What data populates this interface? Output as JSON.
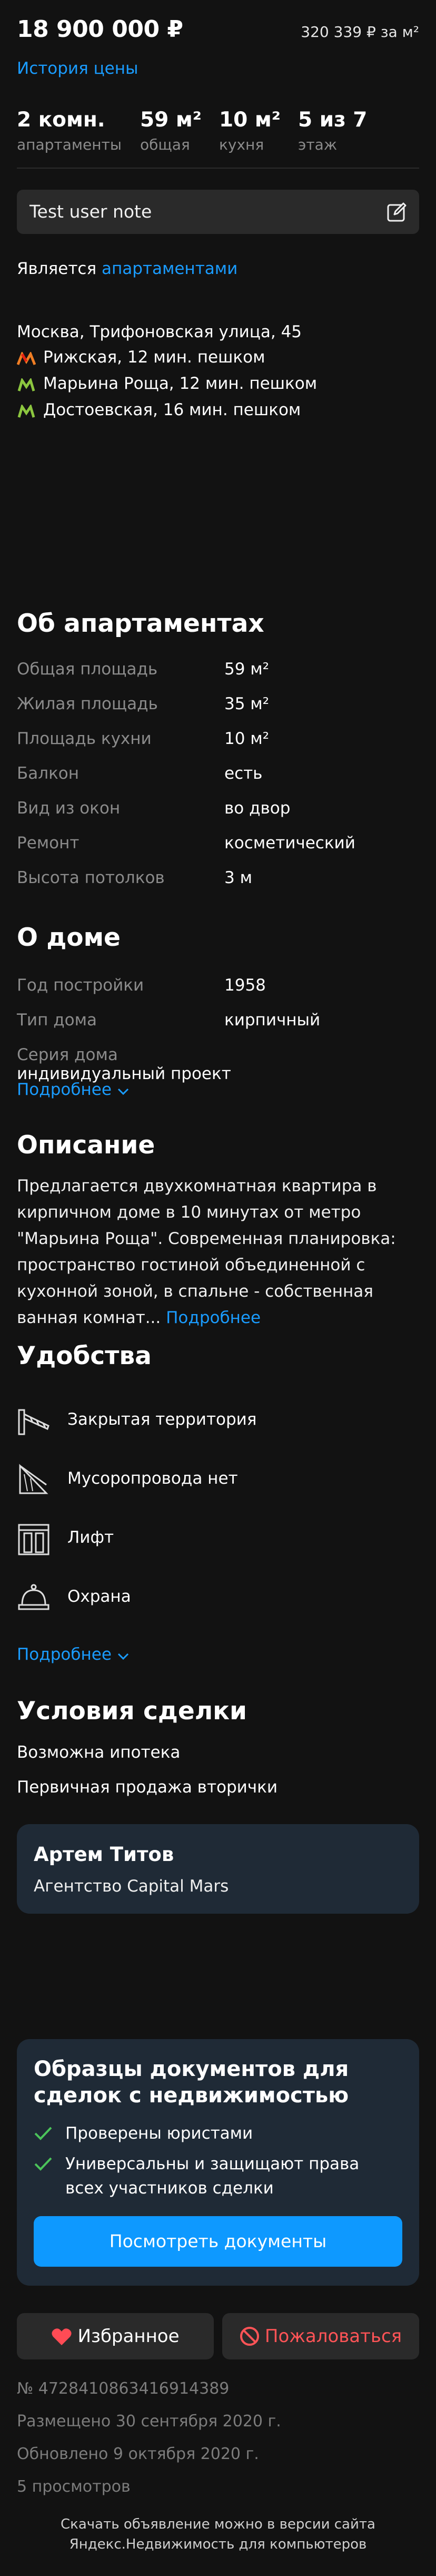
{
  "header": {
    "price": "18 900 000 ₽",
    "price_per_meter": "320 339 ₽ за м²",
    "price_history_link": "История цены"
  },
  "stats": [
    {
      "value": "2 комн.",
      "label": "апартаменты"
    },
    {
      "value": "59 м²",
      "label": "общая"
    },
    {
      "value": "10 м²",
      "label": "кухня"
    },
    {
      "value": "5 из 7",
      "label": "этаж"
    }
  ],
  "note": {
    "text": "Test user note",
    "icon": "edit-icon"
  },
  "type_line": {
    "prefix": "Является",
    "link": "апартаментами"
  },
  "location": {
    "address": "Москва, Трифоновская улица, 45",
    "metro": [
      {
        "text": "Рижская, 12 мин. пешком",
        "colors": [
          "#f07e24",
          "#e42313"
        ],
        "icon": "metro-icon"
      },
      {
        "text": "Марьина Роща, 12 мин. пешком",
        "colors": [
          "#8cc63f"
        ],
        "icon": "metro-icon"
      },
      {
        "text": "Достоевская, 16 мин. пешком",
        "colors": [
          "#8cc63f"
        ],
        "icon": "metro-icon"
      }
    ]
  },
  "about_apartment": {
    "title": "Об апартаментах",
    "rows": [
      {
        "key": "Общая площадь",
        "value": "59 м²"
      },
      {
        "key": "Жилая площадь",
        "value": "35 м²"
      },
      {
        "key": "Площадь кухни",
        "value": "10 м²"
      },
      {
        "key": "Балкон",
        "value": "есть"
      },
      {
        "key": "Вид из окон",
        "value": "во двор"
      },
      {
        "key": "Ремонт",
        "value": "косметический"
      },
      {
        "key": "Высота потолков",
        "value": "3 м"
      }
    ]
  },
  "about_house": {
    "title": "О доме",
    "rows": [
      {
        "key": "Год постройки",
        "value": "1958"
      },
      {
        "key": "Тип дома",
        "value": "кирпичный"
      },
      {
        "key": "Серия дома",
        "value": "индивидуальный проект"
      }
    ],
    "more": "Подробнее"
  },
  "description": {
    "title": "Описание",
    "text": "Предлагается двухкомнатная квартира в кирпичном доме в 10 минутах от метро \"Марьина Роща\". Современная планировка: пространство гостиной объединенной с кухонной зоной, в спальне - собственная ванная комнат...",
    "more": "Подробнее"
  },
  "amenities": {
    "title": "Удобства",
    "items": [
      {
        "label": "Закрытая территория",
        "icon": "barrier-icon"
      },
      {
        "label": "Мусоропровода нет",
        "icon": "chute-icon"
      },
      {
        "label": "Лифт",
        "icon": "elevator-icon"
      },
      {
        "label": "Охрана",
        "icon": "bell-icon"
      }
    ],
    "more": "Подробнее"
  },
  "deal": {
    "title": "Условия сделки",
    "items": [
      "Возможна ипотека",
      "Первичная продажа вторички"
    ]
  },
  "agent": {
    "name": "Артем Титов",
    "company": "Агентство Capital Mars"
  },
  "documents": {
    "title": "Образцы документов для сделок с недвижимостью",
    "items": [
      "Проверены юристами",
      "Универсальны и защищают права всех участников сделки"
    ],
    "button": "Посмотреть документы",
    "accent": "#0e99ff"
  },
  "actions": {
    "favorite": "Избранное",
    "complain": "Пожаловаться",
    "complain_color": "#ff5457"
  },
  "meta": {
    "id": "№ 4728410863416914389",
    "posted": "Размещено 30 сентября 2020 г.",
    "updated": "Обновлено 9 октября 2020 г.",
    "views": "5 просмотров"
  },
  "footer": {
    "line1": "Скачать объявление можно в версии сайта",
    "line2": "Яндекс.Недвижимость для компьютеров"
  }
}
